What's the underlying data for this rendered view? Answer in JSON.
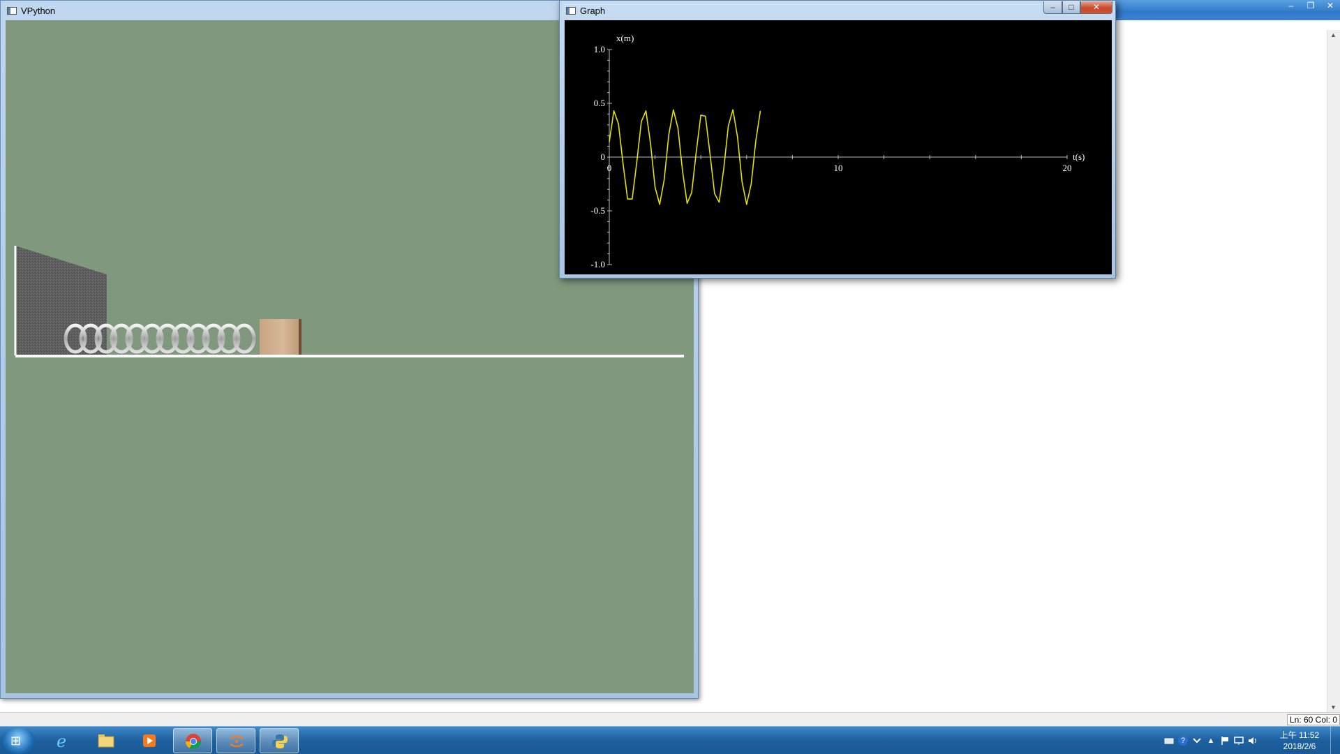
{
  "background_window": {
    "minimize": "–",
    "restore": "❐",
    "close": "✕",
    "status": "Ln: 60 Col: 0"
  },
  "vpython_window": {
    "title": "VPython"
  },
  "graph_window": {
    "title": "Graph",
    "minimize": "–",
    "maximize": "□",
    "close": "✕"
  },
  "chart_data": {
    "type": "line",
    "xlabel": "t(s)",
    "ylabel": "x(m)",
    "xlim": [
      0,
      20
    ],
    "ylim": [
      -1.0,
      1.0
    ],
    "x_ticks": [
      "0",
      "10",
      "20"
    ],
    "y_ticks": [
      "1.0",
      "0.5",
      "0",
      "-0.5",
      "-1.0"
    ],
    "grid": false,
    "series": [
      {
        "color": "#e6e200",
        "x": [
          0,
          0.2,
          0.4,
          0.6,
          0.8,
          1.0,
          1.2,
          1.4,
          1.6,
          1.8,
          2.0,
          2.2,
          2.4,
          2.6,
          2.8,
          3.0,
          3.2,
          3.4,
          3.6,
          3.8,
          4.0,
          4.2,
          4.4,
          4.6,
          4.8,
          5.0,
          5.2,
          5.4,
          5.6,
          5.8,
          6.0,
          6.2,
          6.4,
          6.6
        ],
        "y": [
          0.14,
          0.43,
          0.31,
          -0.06,
          -0.39,
          -0.39,
          -0.05,
          0.33,
          0.43,
          0.13,
          -0.28,
          -0.44,
          -0.21,
          0.21,
          0.44,
          0.27,
          -0.13,
          -0.43,
          -0.33,
          0.05,
          0.39,
          0.38,
          0.03,
          -0.34,
          -0.42,
          -0.11,
          0.29,
          0.44,
          0.19,
          -0.23,
          -0.44,
          -0.25,
          0.15,
          0.43
        ]
      }
    ]
  },
  "taskbar": {
    "start_icon": "⊞",
    "items": [
      {
        "name": "internet-explorer",
        "active": false
      },
      {
        "name": "file-explorer",
        "active": false
      },
      {
        "name": "media-player",
        "active": false
      },
      {
        "name": "chrome",
        "active": true
      },
      {
        "name": "app-orange",
        "active": true
      },
      {
        "name": "python",
        "active": true
      }
    ],
    "tray_question": "?",
    "tray_up": "▲",
    "time": "上午 11:52",
    "date": "2018/2/6"
  }
}
